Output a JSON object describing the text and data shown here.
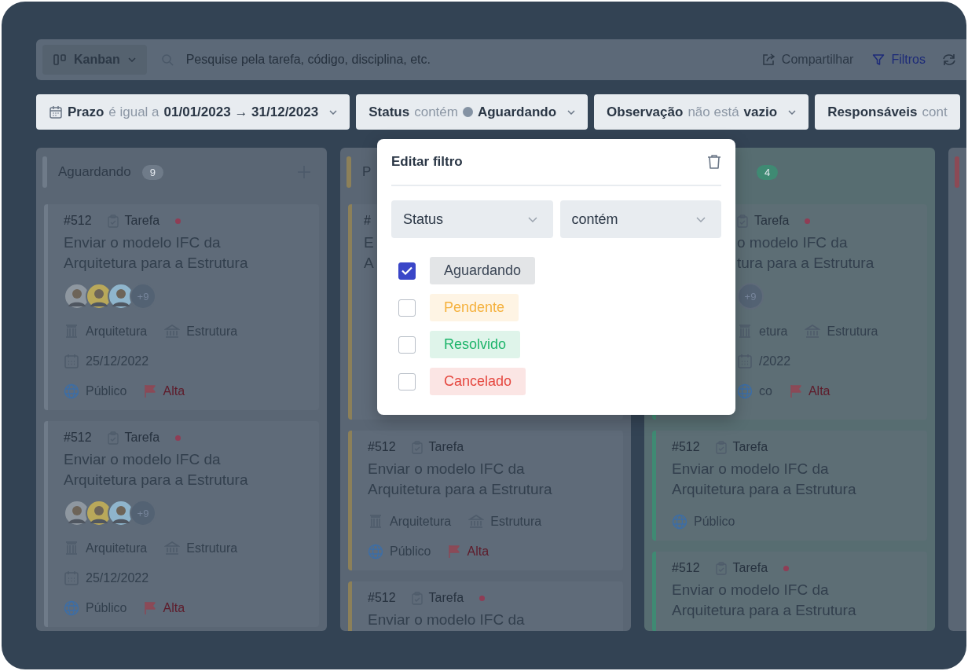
{
  "toolbar": {
    "view": "Kanban",
    "search_placeholder": "Pesquise pela tarefa, código, disciplina, etc.",
    "actions": [
      {
        "kind": "share",
        "label": "Compartilhar",
        "selected": false
      },
      {
        "kind": "filter",
        "label": "Filtros",
        "selected": true
      },
      {
        "kind": "refresh"
      }
    ]
  },
  "filters": [
    {
      "kind": "date",
      "field": "Prazo",
      "operator": "é igual a",
      "value": "01/01/2023 → 31/12/2023"
    },
    {
      "kind": "status",
      "field": "Status",
      "operator": "contém",
      "value": "Aguardando"
    },
    {
      "kind": "text",
      "field": "Observação",
      "operator": "não está",
      "value": "vazio"
    },
    {
      "kind": "cut",
      "field": "Responsáveis",
      "operator": "cont"
    }
  ],
  "columns": [
    {
      "title": "Aguardando",
      "count": "9",
      "color": "#6f7b89",
      "add": true,
      "cards": [
        {
          "kind": "full",
          "code": "#512",
          "type": "Tarefa",
          "flagged": true,
          "title": [
            "Enviar o modelo IFC da",
            "Arquitetura para a Estrutura"
          ],
          "avatars": [
            {
              "color": "#8e97a0"
            },
            {
              "color": "#b9a85a"
            },
            {
              "color": "#8fb5cc"
            }
          ],
          "more": "+9",
          "from": "Arquitetura",
          "to": "Estrutura",
          "date": "25/12/2022",
          "visibility": "Público",
          "priority": "Alta"
        },
        {
          "kind": "full",
          "code": "#512",
          "type": "Tarefa",
          "flagged": true,
          "title": [
            "Enviar o modelo IFC da",
            "Arquitetura para a Estrutura"
          ],
          "avatars": [
            {
              "color": "#8e97a0"
            },
            {
              "color": "#b9a85a"
            },
            {
              "color": "#8fb5cc"
            }
          ],
          "more": "+9",
          "from": "Arquitetura",
          "to": "Estrutura",
          "date": "25/12/2022",
          "visibility": "Público",
          "priority": "Alta"
        }
      ]
    },
    {
      "title": "P",
      "color": "#8c8059",
      "add": false,
      "cards": [
        {
          "kind": "partial",
          "code": "#",
          "title": [
            "E",
            "A"
          ]
        },
        {
          "kind": "full",
          "code": "#512",
          "type": "Tarefa",
          "flagged": false,
          "title": [
            "Enviar o modelo IFC da",
            "Arquitetura para a Estrutura"
          ],
          "from": "Arquitetura",
          "to": "Estrutura",
          "visibility": "Público",
          "priority": "Alta"
        },
        {
          "kind": "full",
          "code": "#512",
          "type": "Tarefa",
          "flagged": true,
          "title": [
            "Enviar o modelo IFC da"
          ]
        }
      ]
    },
    {
      "count": "4",
      "color": "#3f8a73",
      "add": false,
      "cards": [
        {
          "kind": "shifted",
          "type": "Tarefa",
          "flagged": true,
          "title": [
            "o modelo IFC da",
            "tura para a Estrutura"
          ],
          "more": "+9",
          "from": "etura",
          "to": "Estrutura",
          "date": "/2022",
          "visibility": "co",
          "priority": "Alta"
        },
        {
          "kind": "full",
          "code": "#512",
          "type": "Tarefa",
          "flagged": false,
          "title": [
            "Enviar o modelo IFC da",
            "Arquitetura para a Estrutura"
          ],
          "visibility": "Público"
        },
        {
          "kind": "full",
          "code": "#512",
          "type": "Tarefa",
          "flagged": true,
          "title": [
            "Enviar o modelo IFC da",
            "Arquitetura para a Estrutura"
          ]
        }
      ]
    },
    {
      "color": "#8c4a55",
      "add": false
    }
  ],
  "popup": {
    "title": "Editar filtro",
    "field": "Status",
    "operator": "contém",
    "options": [
      {
        "label": "Aguardando",
        "checked": true,
        "color": "#3b4656"
      },
      {
        "label": "Pendente",
        "checked": false,
        "color": "#f5b13d"
      },
      {
        "label": "Resolvido",
        "checked": false,
        "color": "#1db46a"
      },
      {
        "label": "Cancelado",
        "checked": false,
        "color": "#e5473f"
      }
    ]
  }
}
